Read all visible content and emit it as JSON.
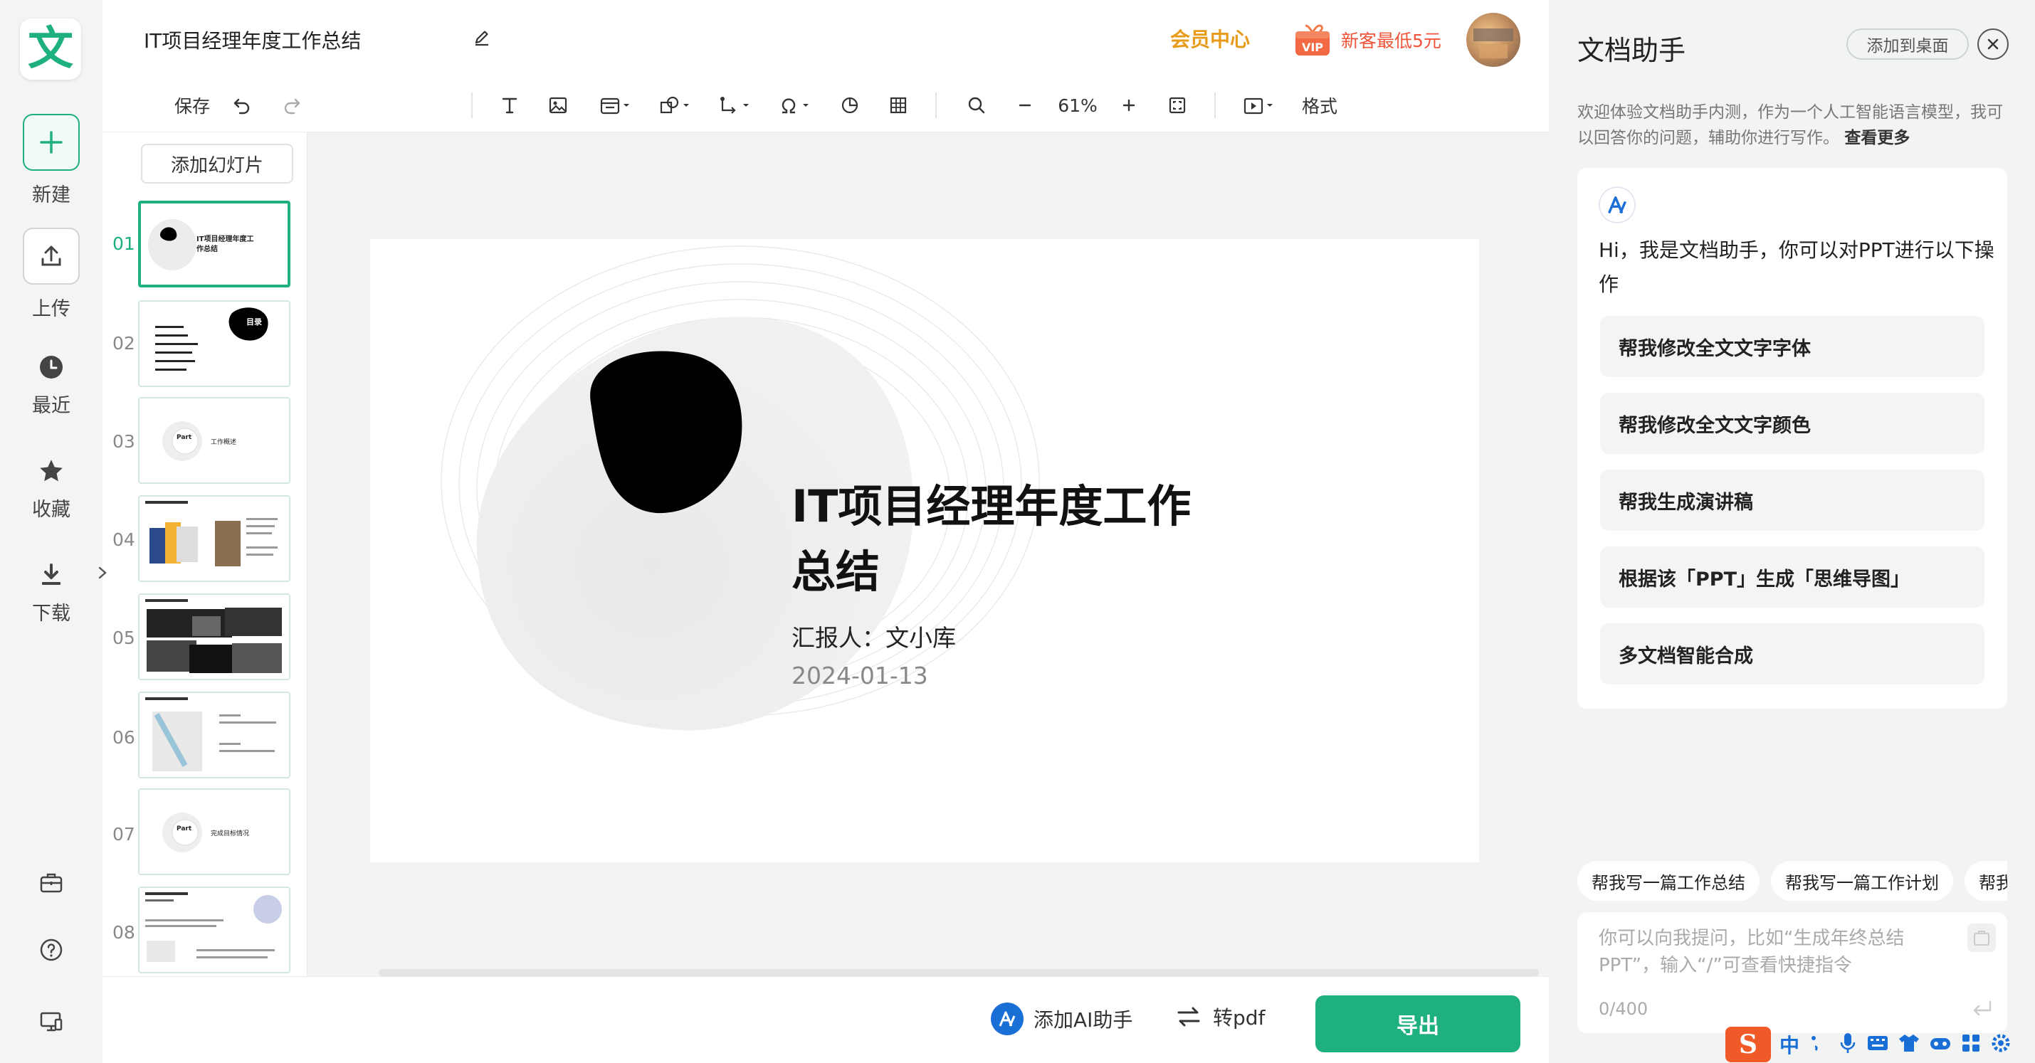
{
  "rail": {
    "logo_char": "文",
    "new_label": "新建",
    "upload_label": "上传",
    "recent_label": "最近",
    "favorites_label": "收藏",
    "download_label": "下载"
  },
  "header": {
    "doc_title": "IT项目经理年度工作总结",
    "member_center": "会员中心",
    "vip_badge": "VIP",
    "promo": "新客最低5元"
  },
  "toolbar": {
    "save": "保存",
    "zoom": "61%",
    "format": "格式"
  },
  "slides_panel": {
    "add_slide": "添加幻灯片",
    "thumbnails": [
      {
        "num": "01",
        "title": "IT项目经理年度工作总结"
      },
      {
        "num": "02",
        "title": "目录"
      },
      {
        "num": "03",
        "part": "Part",
        "label": "工作概述"
      },
      {
        "num": "04"
      },
      {
        "num": "05"
      },
      {
        "num": "06"
      },
      {
        "num": "07",
        "part": "Part",
        "label": "完成目标情况"
      },
      {
        "num": "08"
      }
    ]
  },
  "slide": {
    "title_line1": "IT项目经理年度工作",
    "title_line2": "总结",
    "reporter": "汇报人：文小库",
    "date": "2024-01-13"
  },
  "bottombar": {
    "ai_assistant": "添加AI助手",
    "to_pdf": "转pdf",
    "export": "导出"
  },
  "assistant": {
    "title": "文档助手",
    "add_desktop": "添加到桌面",
    "intro": "欢迎体验文档助手内测，作为一个人工智能语言模型，我可以回答你的问题，辅助你进行写作。",
    "see_more": "查看更多",
    "greeting": "Hi，我是文档助手，你可以对PPT进行以下操作",
    "suggestions": [
      "帮我修改全文文字字体",
      "帮我修改全文文字颜色",
      "帮我生成演讲稿",
      "根据该「PPT」生成「思维导图」",
      "多文档智能合成"
    ],
    "chips": [
      "帮我写一篇工作总结",
      "帮我写一篇工作计划",
      "帮我"
    ],
    "input_placeholder": "你可以向我提问，比如“生成年终总结PPT”，输入“/”可查看快捷指令",
    "char_count": "0/400"
  },
  "ime": {
    "logo": "S",
    "mode": "中"
  },
  "colors": {
    "accent": "#1fb07f",
    "member": "#e89b1a",
    "promo": "#f0543a"
  }
}
